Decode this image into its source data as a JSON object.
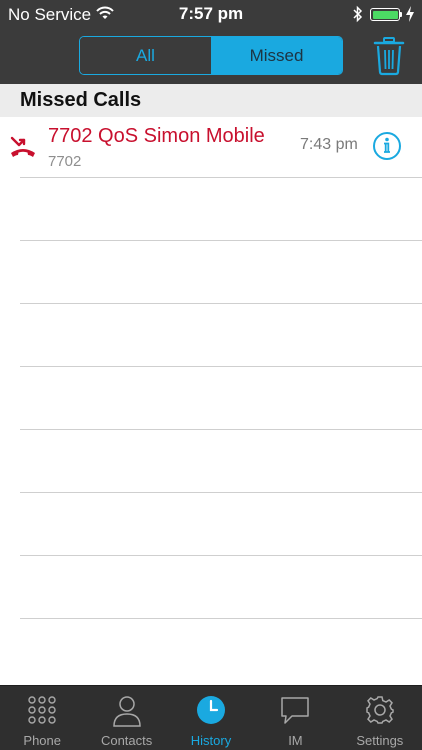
{
  "status_bar": {
    "carrier": "No Service",
    "time": "7:57 pm",
    "icons": [
      "wifi-icon",
      "bluetooth-icon",
      "battery-icon",
      "charging-bolt-icon"
    ]
  },
  "header": {
    "segments": [
      "All",
      "Missed"
    ],
    "selected_segment": "Missed",
    "trash_icon": "trash-icon"
  },
  "section": {
    "title": "Missed Calls"
  },
  "calls": [
    {
      "name": "7702 QoS Simon Mobile",
      "number": "7702",
      "time": "7:43 pm",
      "icon": "missed-call-icon"
    }
  ],
  "tabs": [
    {
      "label": "Phone",
      "icon": "keypad-icon"
    },
    {
      "label": "Contacts",
      "icon": "person-icon"
    },
    {
      "label": "History",
      "icon": "clock-icon"
    },
    {
      "label": "IM",
      "icon": "chat-bubble-icon"
    },
    {
      "label": "Settings",
      "icon": "gear-icon"
    }
  ],
  "active_tab": "History",
  "colors": {
    "accent": "#1aa9e0",
    "header_bg": "#3b3b3b",
    "missed_red": "#c8102e",
    "tabbar_bg": "#2f2f2f"
  }
}
